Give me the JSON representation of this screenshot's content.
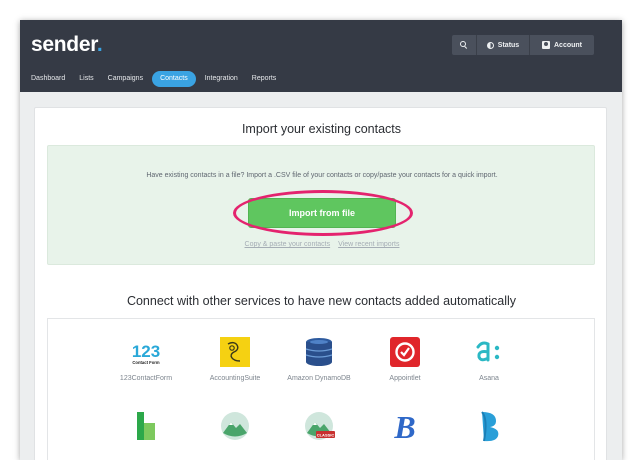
{
  "app": {
    "logo": "sender",
    "logo_dot": "."
  },
  "header": {
    "search_icon": "search-icon",
    "status_label": "Status",
    "account_label": "Account"
  },
  "nav": {
    "tabs": [
      {
        "label": "Dashboard",
        "active": false
      },
      {
        "label": "Lists",
        "active": false
      },
      {
        "label": "Campaigns",
        "active": false
      },
      {
        "label": "Contacts",
        "active": true
      },
      {
        "label": "Integration",
        "active": false
      },
      {
        "label": "Reports",
        "active": false
      }
    ]
  },
  "import": {
    "title": "Import your existing contacts",
    "description": "Have existing contacts in a file? Import a .CSV file of your contacts or copy/paste your contacts for a quick import.",
    "button_label": "Import from file",
    "copy_paste_link": "Copy & paste your contacts",
    "recent_link": "View recent imports"
  },
  "connect": {
    "title": "Connect with other services to have new contacts added automatically",
    "integrations": [
      {
        "name": "123ContactForm",
        "logo_text": "123",
        "logo_subtext": "Contact Form",
        "icon": "123contactform-logo"
      },
      {
        "name": "AccountingSuite",
        "icon": "accountingsuite-logo"
      },
      {
        "name": "Amazon DynamoDB",
        "icon": "dynamodb-logo"
      },
      {
        "name": "Appointlet",
        "icon": "appointlet-logo"
      },
      {
        "name": "Asana",
        "icon": "asana-logo"
      },
      {
        "name": "",
        "icon": "green-building-logo"
      },
      {
        "name": "",
        "icon": "basecamp-logo"
      },
      {
        "name": "",
        "icon": "basecamp-classic-logo",
        "badge": "CLASSIC"
      },
      {
        "name": "",
        "logo_text": "B",
        "icon": "blue-b-logo"
      },
      {
        "name": "",
        "icon": "blue-ribbon-logo"
      }
    ]
  },
  "colors": {
    "topbar": "#353a45",
    "accent_blue": "#3aa3e3",
    "import_green": "#5fc65f",
    "highlight_pink": "#e4236e",
    "panel_green": "#e8f3ea"
  }
}
